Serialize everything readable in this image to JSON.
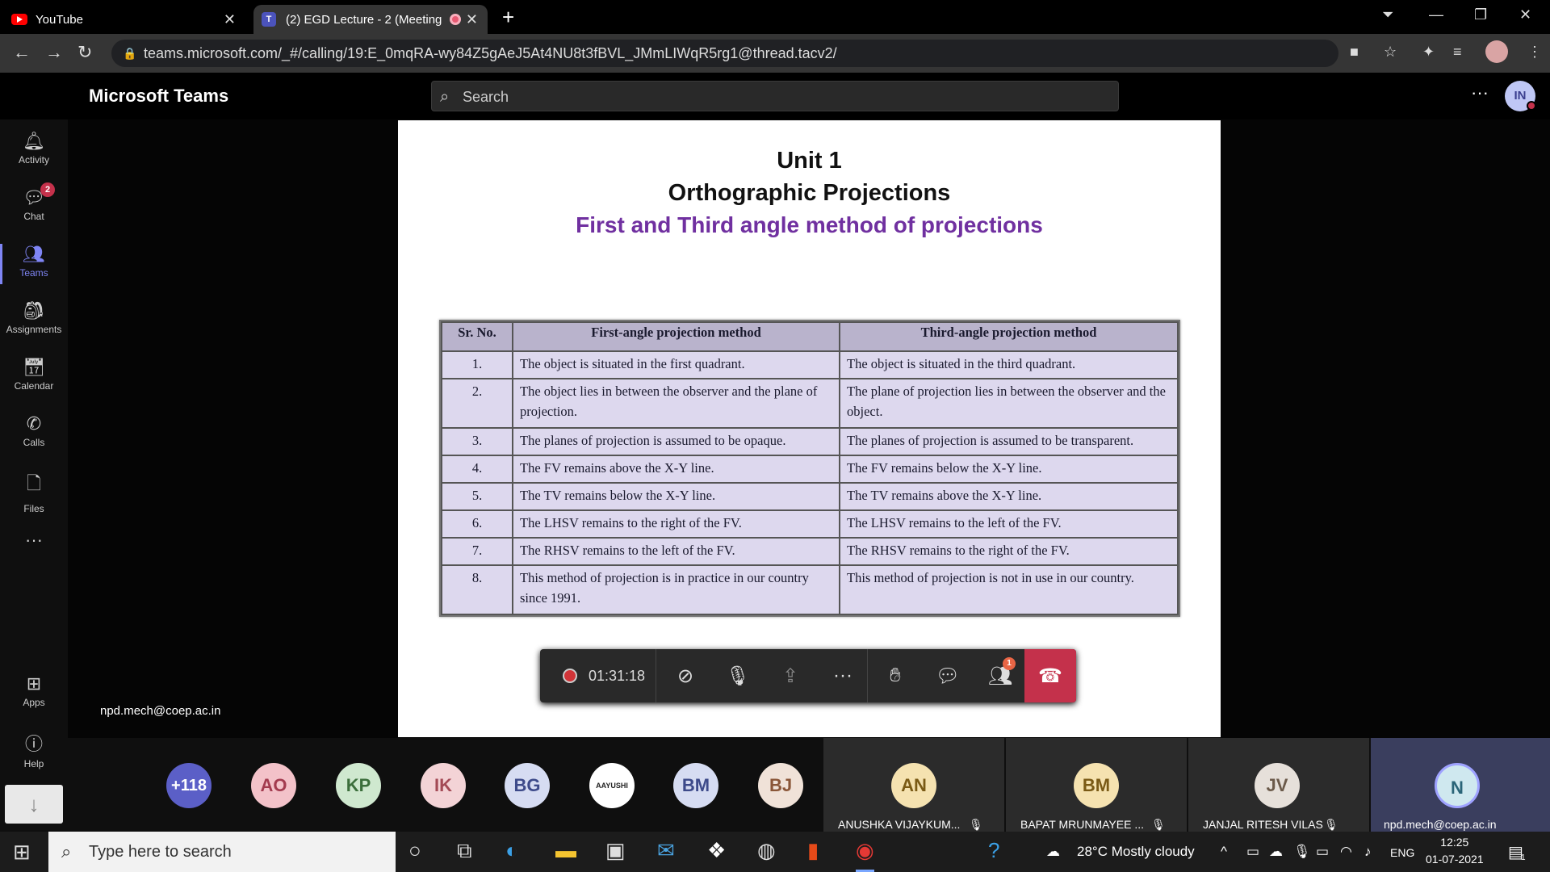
{
  "browser": {
    "tabs": [
      {
        "title": "YouTube"
      },
      {
        "title": "(2) EGD Lecture - 2 (Meeting"
      }
    ],
    "url": "teams.microsoft.com/_#/calling/19:E_0mqRA-wy84Z5gAeJ5At4NU8t3fBVL_JMmLIWqR5rg1@thread.tacv2/"
  },
  "teams": {
    "brand": "Microsoft Teams",
    "search_placeholder": "Search",
    "user_initials": "IN",
    "rail": [
      {
        "label": "Activity",
        "icon": "bell-icon"
      },
      {
        "label": "Chat",
        "icon": "chat-icon",
        "badge": "2"
      },
      {
        "label": "Teams",
        "icon": "teams-icon"
      },
      {
        "label": "Assignments",
        "icon": "assignments-icon"
      },
      {
        "label": "Calendar",
        "icon": "calendar-icon"
      },
      {
        "label": "Calls",
        "icon": "phone-icon"
      },
      {
        "label": "Files",
        "icon": "file-icon"
      }
    ],
    "rail_bottom": [
      {
        "label": "Apps",
        "icon": "apps-icon"
      },
      {
        "label": "Help",
        "icon": "help-icon"
      }
    ]
  },
  "slide": {
    "title1": "Unit 1",
    "title2": "Orthographic Projections",
    "subtitle": "First and Third angle method of projections",
    "table": {
      "headers": [
        "Sr. No.",
        "First-angle projection method",
        "Third-angle projection method"
      ],
      "rows": [
        [
          "1.",
          "The object is situated in the first quadrant.",
          "The object is situated in the third quadrant."
        ],
        [
          "2.",
          "The object lies in between the observer and the plane of projection.",
          "The plane of projection lies in between the observer and the object."
        ],
        [
          "3.",
          "The planes of projection is assumed to be opaque.",
          "The planes of projection is assumed to be transparent."
        ],
        [
          "4.",
          "The FV remains above the X-Y line.",
          "The FV remains below the X-Y line."
        ],
        [
          "5.",
          "The TV remains below the X-Y line.",
          "The TV remains above the X-Y line."
        ],
        [
          "6.",
          "The LHSV remains to the right of the FV.",
          "The LHSV remains to the left of the FV."
        ],
        [
          "7.",
          "The RHSV remains to the left of the FV.",
          "The RHSV remains to the right of the FV."
        ],
        [
          "8.",
          "This method of projection is in practice in our country since 1991.",
          "This method of projection is not in use in our country."
        ]
      ]
    }
  },
  "presenter": "npd.mech@coep.ac.in",
  "call": {
    "timer": "01:31:18",
    "participants_badge": "1",
    "accent": "#c4314b"
  },
  "participants": {
    "overflow": "+118",
    "avatars": [
      {
        "initials": "AO",
        "bg": "#f3c2c9",
        "fg": "#a33b4f"
      },
      {
        "initials": "KP",
        "bg": "#cfe8cf",
        "fg": "#3b6e3b"
      },
      {
        "initials": "IK",
        "bg": "#f3d3d6",
        "fg": "#a34a55"
      },
      {
        "initials": "BG",
        "bg": "#d6dcf2",
        "fg": "#3d4a8a"
      },
      {
        "initials": "AAYUSHI",
        "bg": "#ffffff",
        "fg": "#222222"
      },
      {
        "initials": "BM",
        "bg": "#d6dcf2",
        "fg": "#3d4a8a"
      },
      {
        "initials": "BJ",
        "bg": "#f0e2d8",
        "fg": "#8a5638"
      }
    ],
    "tiles": [
      {
        "initials": "AN",
        "name": "ANUSHKA VIJAYKUM...",
        "bg": "#f5e2b0",
        "fg": "#7a5a15"
      },
      {
        "initials": "BM",
        "name": "BAPAT MRUNMAYEE ...",
        "bg": "#f5e2b0",
        "fg": "#7a5a15"
      },
      {
        "initials": "JV",
        "name": "JANJAL RITESH VILAS",
        "bg": "#e6e0da",
        "fg": "#6b5a4a"
      },
      {
        "initials": "N",
        "name": "npd.mech@coep.ac.in",
        "bg": "#cfe8ef",
        "fg": "#2a6478"
      }
    ]
  },
  "taskbar": {
    "search_placeholder": "Type here to search",
    "weather": "28°C  Mostly cloudy",
    "lang": "ENG",
    "time": "12:25",
    "date": "01-07-2021",
    "notif_count": "1"
  }
}
